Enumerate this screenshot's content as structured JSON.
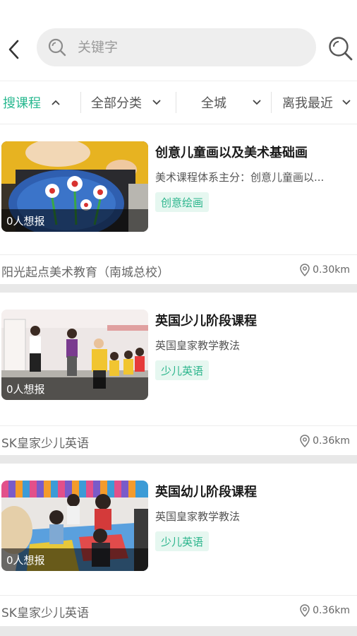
{
  "search": {
    "placeholder": "关键字"
  },
  "filters": [
    {
      "label": "搜课程",
      "active": true,
      "chevron": "up"
    },
    {
      "label": "全部分类",
      "active": false,
      "chevron": "down"
    },
    {
      "label": "全城",
      "active": false,
      "chevron": "down"
    },
    {
      "label": "离我最近",
      "active": false,
      "chevron": "down"
    }
  ],
  "colors": {
    "accent": "#27b88f",
    "tag_bg": "#e6f7f0",
    "divider": "#e8e8e8"
  },
  "courses": [
    {
      "title": "创意儿童画以及美术基础画",
      "desc": "美术课程体系主分：创意儿童画以...",
      "tag": "创意绘画",
      "want": "0人想报",
      "school": "阳光起点美术教育（南城总校）",
      "distance": "0.30km",
      "image": "art-class-photo"
    },
    {
      "title": "英国少儿阶段课程",
      "desc": "英国皇家教学教法",
      "tag": "少儿英语",
      "want": "0人想报",
      "school": "SK皇家少儿英语",
      "distance": "0.36km",
      "image": "english-classroom-photo"
    },
    {
      "title": "英国幼儿阶段课程",
      "desc": "英国皇家教学教法",
      "tag": "少儿英语",
      "want": "0人想报",
      "school": "SK皇家少儿英语",
      "distance": "0.36km",
      "image": "toddler-classroom-photo"
    }
  ]
}
